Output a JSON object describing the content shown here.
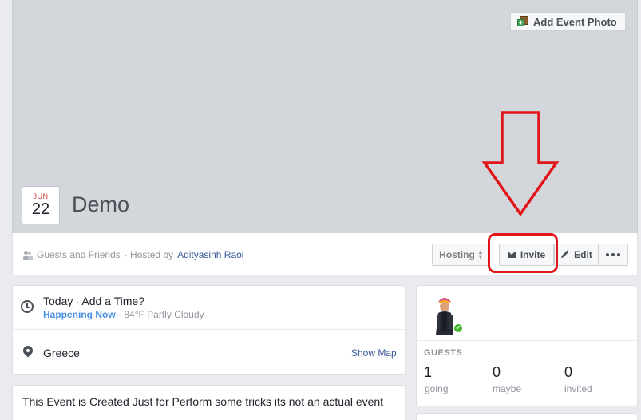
{
  "cover": {
    "add_photo_label": "Add Event Photo"
  },
  "event": {
    "month": "JUN",
    "day": "22",
    "title": "Demo"
  },
  "info_bar": {
    "privacy": "Guests and Friends",
    "hosted_by_prefix": "· Hosted by",
    "host_name": "Adityasinh Raol",
    "hosting_label": "Hosting",
    "invite_label": "Invite",
    "edit_label": "Edit"
  },
  "details": {
    "time_main": "Today",
    "time_sep": "·",
    "time_add": "Add a Time?",
    "status": "Happening Now",
    "weather_sep": "·",
    "weather": "84°F Partly Cloudy",
    "location": "Greece",
    "show_map": "Show Map"
  },
  "description": {
    "text": "This Event is Created Just for Perform some tricks its not an actual event"
  },
  "guests": {
    "label": "GUESTS",
    "going_count": "1",
    "going_label": "going",
    "maybe_count": "0",
    "maybe_label": "maybe",
    "invited_count": "0",
    "invited_label": "invited"
  },
  "colors": {
    "annotation_red": "#e0161b",
    "link_blue": "#365899",
    "happening_blue": "#4a90e2",
    "going_check": "#42b72a"
  },
  "icons": [
    "add-photo-icon",
    "guests-icon",
    "envelope-icon",
    "pencil-icon",
    "more-icon",
    "clock-icon",
    "location-pin-icon",
    "check-icon"
  ]
}
